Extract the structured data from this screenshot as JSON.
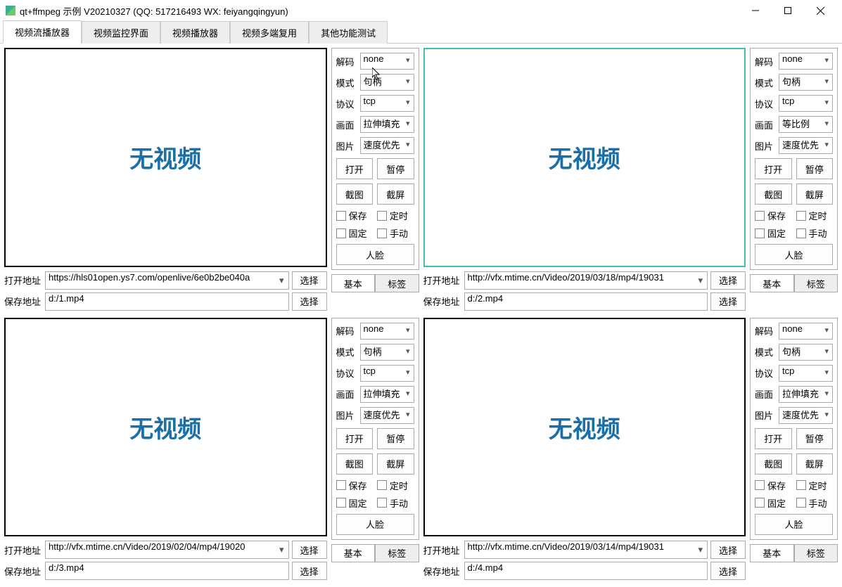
{
  "window": {
    "title": "qt+ffmpeg 示例 V20210327 (QQ: 517216493 WX: feiyangqingyun)"
  },
  "tabs": [
    "视频流播放器",
    "视频监控界面",
    "视频播放器",
    "视频多端复用",
    "其他功能测试"
  ],
  "no_video_text": "无视频",
  "labels": {
    "open_addr": "打开地址",
    "save_addr": "保存地址",
    "select": "选择",
    "decode": "解码",
    "mode": "模式",
    "protocol": "协议",
    "screen": "画面",
    "picture": "图片",
    "open": "打开",
    "pause": "暂停",
    "snap": "截图",
    "cap": "截屏",
    "save": "保存",
    "timer": "定时",
    "fixed": "固定",
    "manual": "手动",
    "face": "人脸",
    "basic": "基本",
    "tag": "标签"
  },
  "quads": [
    {
      "open_addr": "https://hls01open.ys7.com/openlive/6e0b2be040a",
      "save_addr": "d:/1.mp4",
      "decode": "none",
      "mode": "句柄",
      "protocol": "tcp",
      "screen": "拉伸填充",
      "picture": "速度优先",
      "selected": false
    },
    {
      "open_addr": "http://vfx.mtime.cn/Video/2019/03/18/mp4/19031",
      "save_addr": "d:/2.mp4",
      "decode": "none",
      "mode": "句柄",
      "protocol": "tcp",
      "screen": "等比例",
      "picture": "速度优先",
      "selected": true
    },
    {
      "open_addr": "http://vfx.mtime.cn/Video/2019/02/04/mp4/19020",
      "save_addr": "d:/3.mp4",
      "decode": "none",
      "mode": "句柄",
      "protocol": "tcp",
      "screen": "拉伸填充",
      "picture": "速度优先",
      "selected": false
    },
    {
      "open_addr": "http://vfx.mtime.cn/Video/2019/03/14/mp4/19031",
      "save_addr": "d:/4.mp4",
      "decode": "none",
      "mode": "句柄",
      "protocol": "tcp",
      "screen": "拉伸填充",
      "picture": "速度优先",
      "selected": false
    }
  ]
}
